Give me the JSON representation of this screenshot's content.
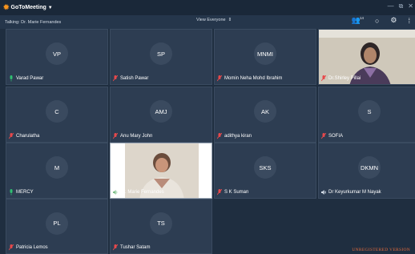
{
  "app": {
    "name": "GoToMeeting",
    "name_prefix": "GoTo",
    "name_suffix": "Meeting"
  },
  "infobar": {
    "talking": "Talking: Dr. Marie Fernandes",
    "view": "View Everyone",
    "attendee_count": "14"
  },
  "tiles": [
    {
      "initials": "VP",
      "name": "Varad  Pawar",
      "mic": "on"
    },
    {
      "initials": "SP",
      "name": "Satish  Pawar",
      "mic": "muted"
    },
    {
      "initials": "MNMI",
      "name": "Momin Neha Mohd  Ibrahim",
      "mic": "muted"
    },
    {
      "initials": "",
      "name": "Dr.Shirley Pillai",
      "mic": "muted",
      "video": true
    },
    {
      "initials": "C",
      "name": "Charulatha",
      "mic": "muted"
    },
    {
      "initials": "AMJ",
      "name": "Anu Mary John",
      "mic": "muted"
    },
    {
      "initials": "AK",
      "name": "adithya kiran",
      "mic": "muted"
    },
    {
      "initials": "S",
      "name": "SOFIA",
      "mic": "muted"
    },
    {
      "initials": "M",
      "name": "MERCY",
      "mic": "on"
    },
    {
      "initials": "",
      "name": "Dr. Marie Fernandes",
      "mic": "speaking",
      "video": true
    },
    {
      "initials": "SKS",
      "name": "S K Suman",
      "mic": "muted"
    },
    {
      "initials": "DKMN",
      "name": "Dr Keyurkumar M Nayak",
      "mic": "speaker"
    },
    {
      "initials": "PL",
      "name": "Patricia Lemos",
      "mic": "muted"
    },
    {
      "initials": "TS",
      "name": "Tushar Satam",
      "mic": "muted"
    }
  ],
  "watermark": "UNREGISTERED VERSION"
}
